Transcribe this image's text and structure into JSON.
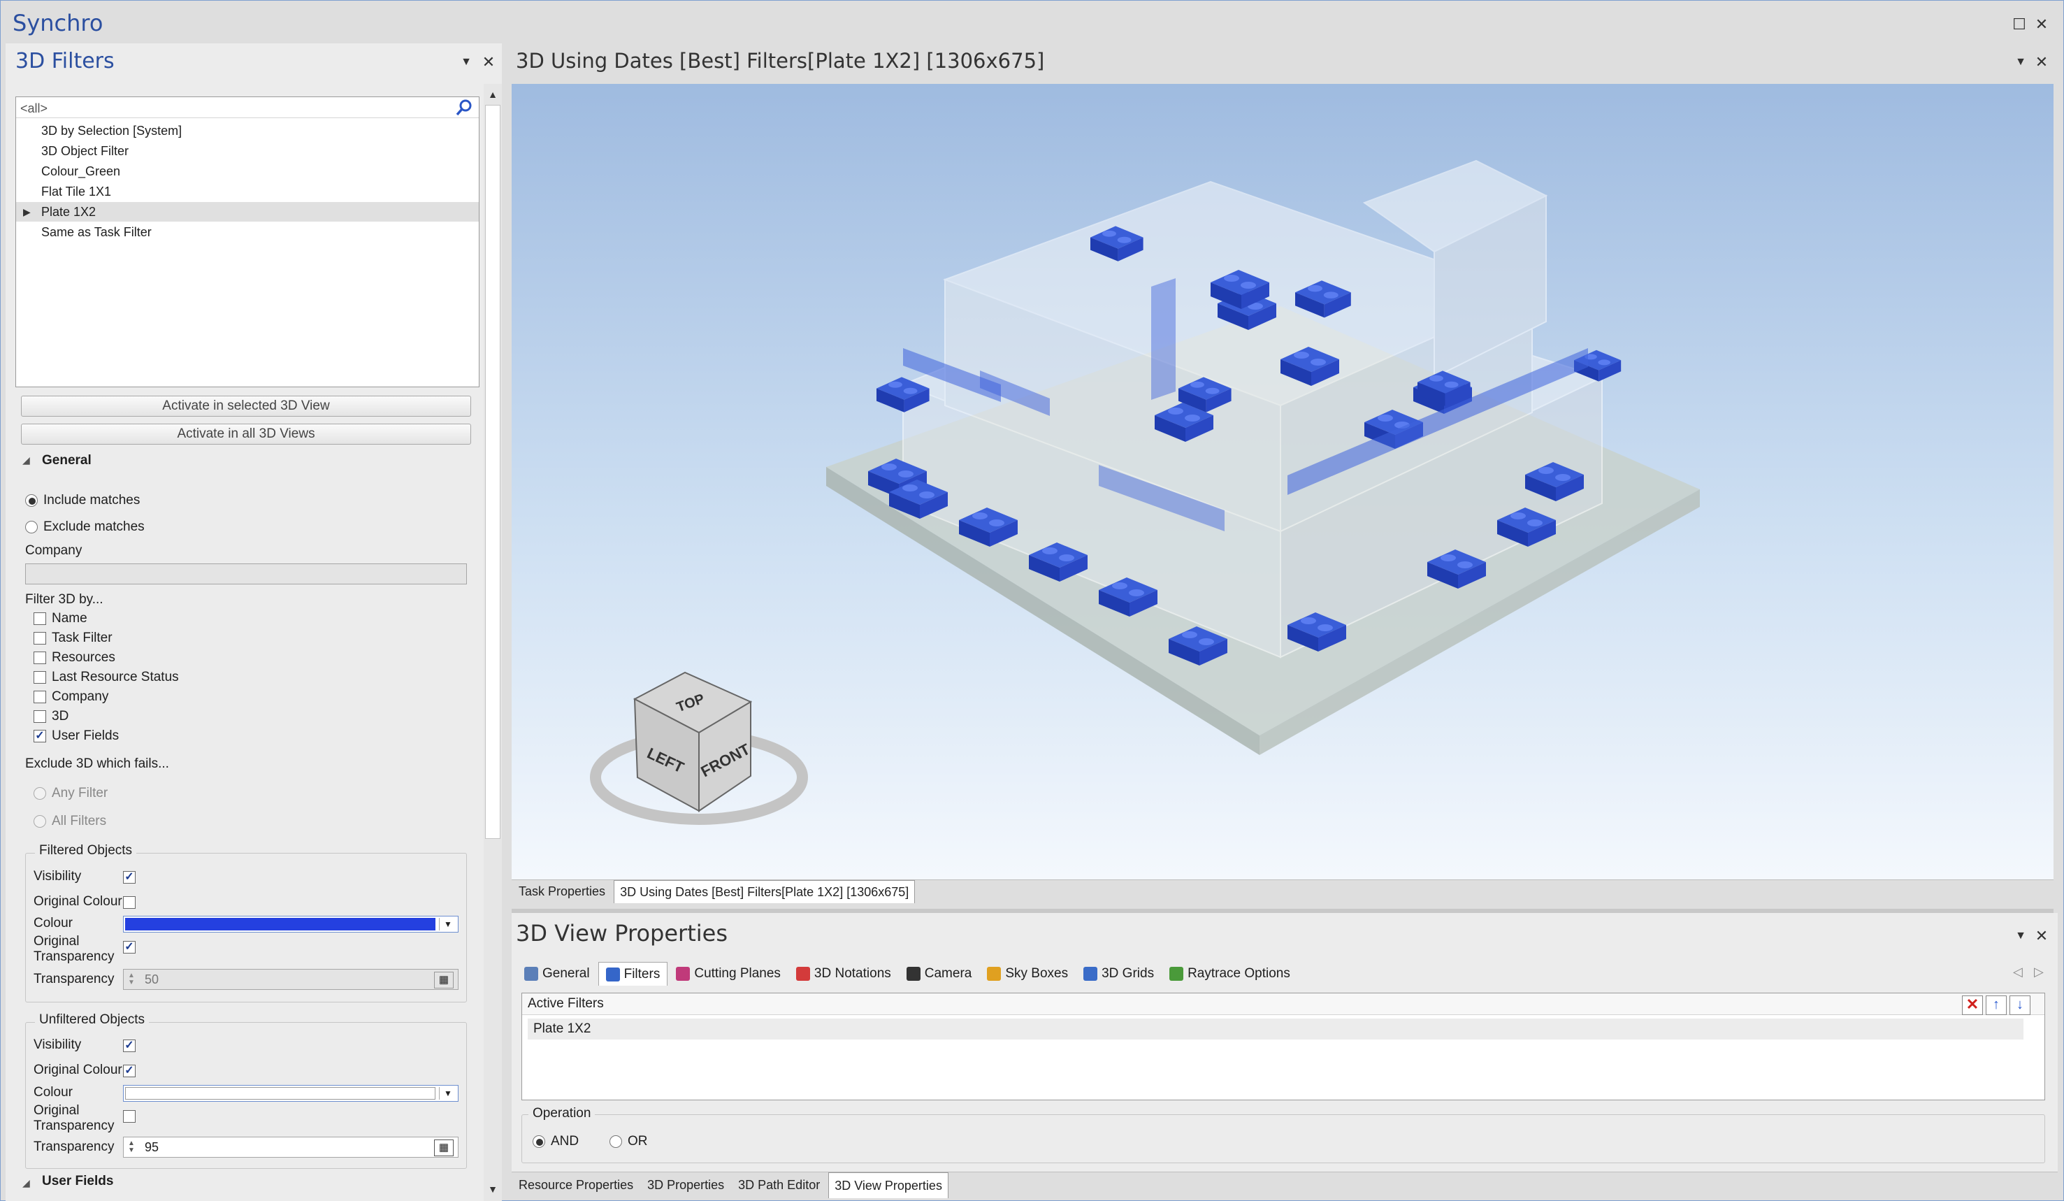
{
  "app": {
    "title": "Synchro"
  },
  "filters_panel": {
    "title": "3D Filters",
    "search_value": "<all>",
    "items": [
      {
        "label": "3D by Selection [System]"
      },
      {
        "label": "3D Object Filter"
      },
      {
        "label": "Colour_Green"
      },
      {
        "label": "Flat Tile 1X1"
      },
      {
        "label": "Plate 1X2",
        "selected": true
      },
      {
        "label": "Same as Task Filter"
      }
    ],
    "activate_selected": "Activate in selected 3D View",
    "activate_all": "Activate in all 3D Views",
    "general_heading": "General",
    "include_matches": "Include matches",
    "exclude_matches": "Exclude matches",
    "company_label": "Company",
    "company_value": "",
    "filter_by_label": "Filter 3D by...",
    "filter_by": [
      {
        "label": "Name",
        "checked": false
      },
      {
        "label": "Task Filter",
        "checked": false
      },
      {
        "label": "Resources",
        "checked": false
      },
      {
        "label": "Last Resource Status",
        "checked": false
      },
      {
        "label": "Company",
        "checked": false
      },
      {
        "label": "3D",
        "checked": false
      },
      {
        "label": "User Fields",
        "checked": true
      }
    ],
    "exclude_label": "Exclude 3D which fails...",
    "any_filter": "Any Filter",
    "all_filters": "All Filters",
    "filtered": {
      "title": "Filtered Objects",
      "visibility": "Visibility",
      "original_colour": "Original Colour",
      "colour": "Colour",
      "original_transparency_1": "Original",
      "original_transparency_2": "Transparency",
      "transparency": "Transparency",
      "transparency_value": "50",
      "colour_hex": "#2440e0"
    },
    "unfiltered": {
      "title": "Unfiltered Objects",
      "visibility": "Visibility",
      "original_colour": "Original Colour",
      "colour": "Colour",
      "original_transparency_1": "Original",
      "original_transparency_2": "Transparency",
      "transparency": "Transparency",
      "transparency_value": "95",
      "colour_hex": "#ffffff"
    },
    "user_fields_heading": "User Fields"
  },
  "view3d": {
    "title": "3D Using Dates [Best] Filters[Plate 1X2] [1306x675]",
    "cube_top": "TOP",
    "cube_left": "LEFT",
    "cube_front": "FRONT"
  },
  "doc_tabs": [
    {
      "label": "Task Properties",
      "active": false
    },
    {
      "label": "3D Using Dates [Best] Filters[Plate 1X2] [1306x675]",
      "active": true
    }
  ],
  "view_props": {
    "title": "3D View Properties",
    "tabs": [
      {
        "label": "General",
        "icon": "document-icon",
        "color": "#5b7fb8"
      },
      {
        "label": "Filters",
        "icon": "filter-icon",
        "color": "#3566c9",
        "active": true
      },
      {
        "label": "Cutting Planes",
        "icon": "cutting-planes-icon",
        "color": "#c03a7a"
      },
      {
        "label": "3D Notations",
        "icon": "notation-icon",
        "color": "#d33b3b"
      },
      {
        "label": "Camera",
        "icon": "camera-icon",
        "color": "#333333"
      },
      {
        "label": "Sky Boxes",
        "icon": "sky-box-icon",
        "color": "#e0a020"
      },
      {
        "label": "3D Grids",
        "icon": "grid-icon",
        "color": "#3a6cc8"
      },
      {
        "label": "Raytrace Options",
        "icon": "raytrace-icon",
        "color": "#4a9a3a"
      }
    ],
    "active_filters_label": "Active Filters",
    "active_filters": [
      "Plate 1X2"
    ],
    "operation_label": "Operation",
    "op_and": "AND",
    "op_or": "OR"
  },
  "bottom_tabs": [
    {
      "label": "Resource Properties",
      "active": false
    },
    {
      "label": "3D Properties",
      "active": false
    },
    {
      "label": "3D Path Editor",
      "active": false
    },
    {
      "label": "3D View Properties",
      "active": true
    }
  ]
}
